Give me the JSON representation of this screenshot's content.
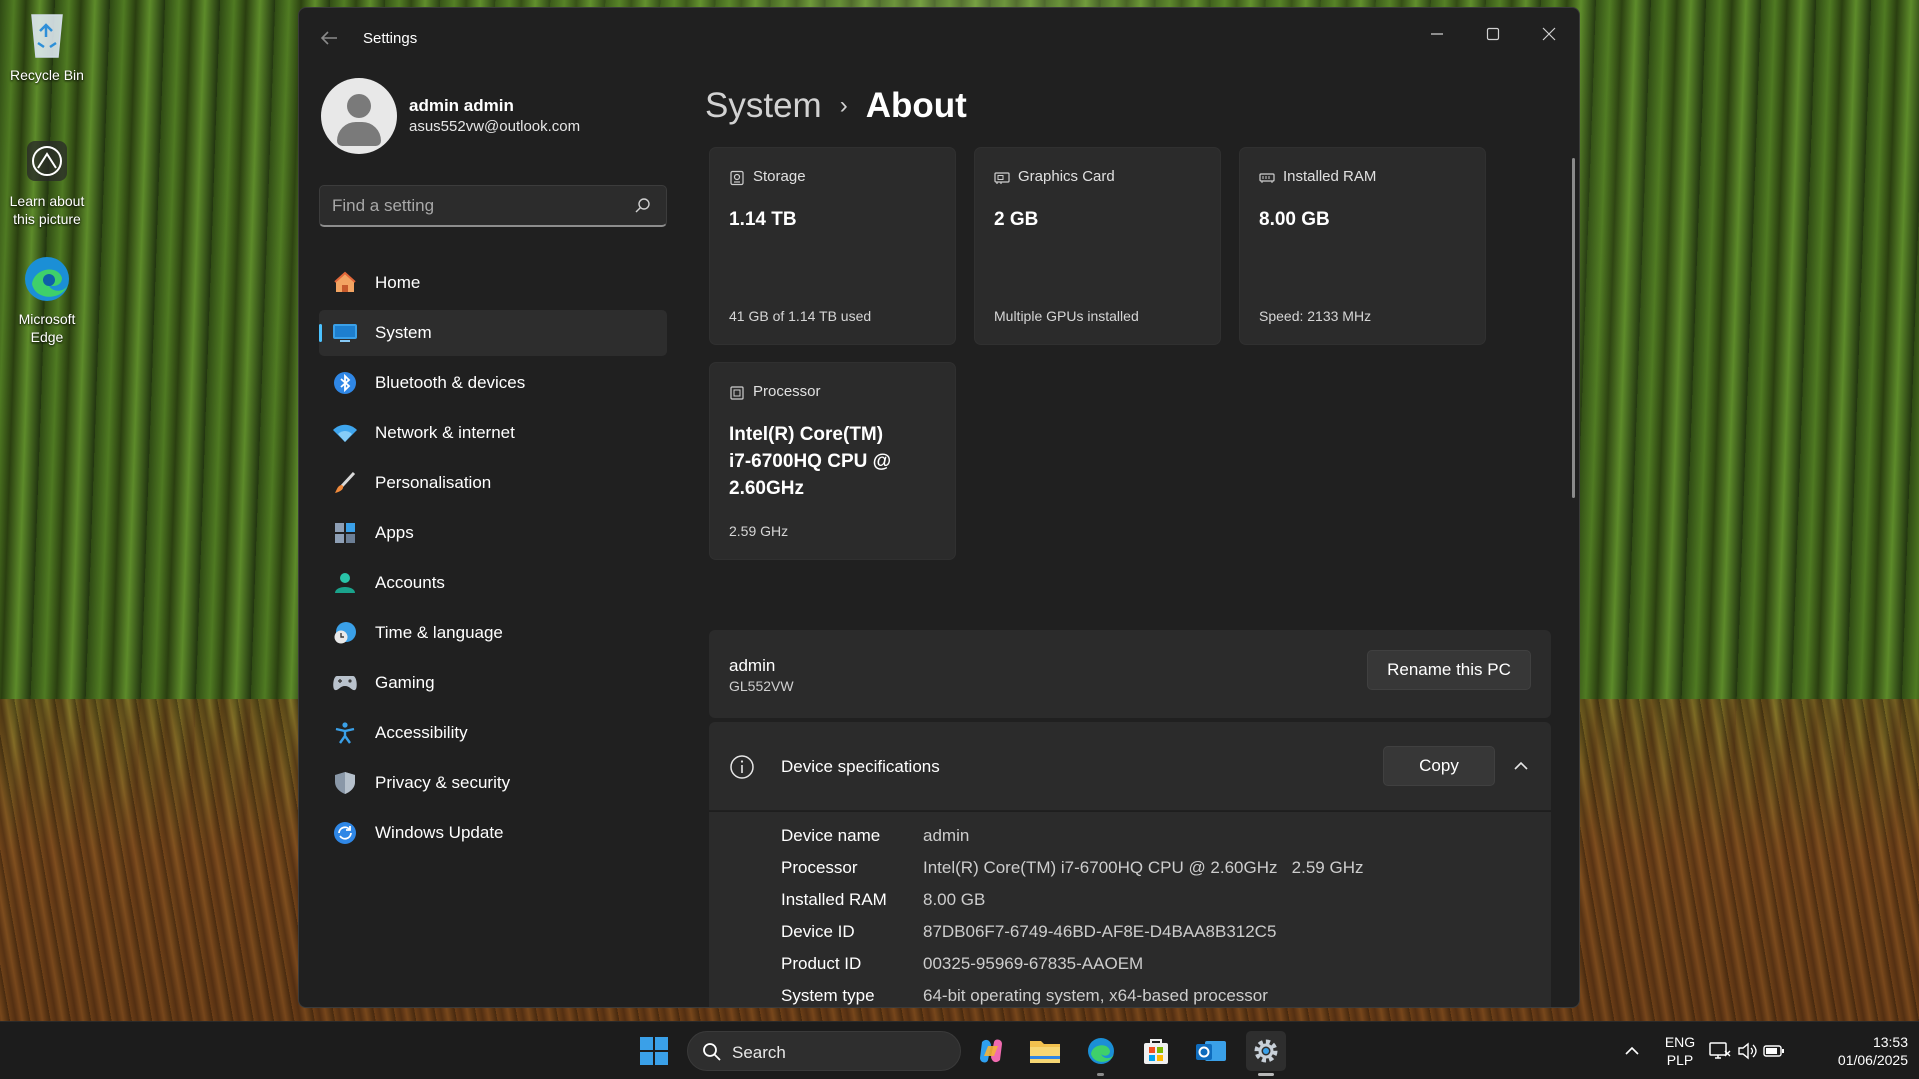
{
  "desktop": {
    "icons": [
      {
        "label": "Recycle Bin"
      },
      {
        "label": "Learn about this picture"
      },
      {
        "label": "Microsoft Edge"
      }
    ]
  },
  "window": {
    "title": "Settings",
    "controls": {
      "minimize": "minimize-icon",
      "maximize": "maximize-icon",
      "close": "close-icon"
    }
  },
  "profile": {
    "name": "admin admin",
    "email": "asus552vw@outlook.com"
  },
  "search": {
    "placeholder": "Find a setting",
    "value": ""
  },
  "nav": {
    "items": [
      {
        "label": "Home",
        "icon": "home-icon"
      },
      {
        "label": "System",
        "icon": "system-icon",
        "active": true
      },
      {
        "label": "Bluetooth & devices",
        "icon": "bluetooth-icon"
      },
      {
        "label": "Network & internet",
        "icon": "wifi-icon"
      },
      {
        "label": "Personalisation",
        "icon": "brush-icon"
      },
      {
        "label": "Apps",
        "icon": "apps-icon"
      },
      {
        "label": "Accounts",
        "icon": "accounts-icon"
      },
      {
        "label": "Time & language",
        "icon": "clock-globe-icon"
      },
      {
        "label": "Gaming",
        "icon": "gamepad-icon"
      },
      {
        "label": "Accessibility",
        "icon": "accessibility-icon"
      },
      {
        "label": "Privacy & security",
        "icon": "shield-icon"
      },
      {
        "label": "Windows Update",
        "icon": "update-icon"
      }
    ]
  },
  "breadcrumb": {
    "parent": "System",
    "separator": "›",
    "current": "About"
  },
  "cards": {
    "storage": {
      "label": "Storage",
      "value": "1.14 TB",
      "sub": "41 GB of 1.14 TB used"
    },
    "graphics": {
      "label": "Graphics Card",
      "value": "2 GB",
      "sub": "Multiple GPUs installed"
    },
    "ram": {
      "label": "Installed RAM",
      "value": "8.00 GB",
      "sub": "Speed: 2133 MHz"
    },
    "processor": {
      "label": "Processor",
      "value_lines": [
        "Intel(R) Core(TM)",
        "i7-6700HQ CPU @",
        "2.60GHz"
      ],
      "sub": "2.59 GHz"
    }
  },
  "pc": {
    "name": "admin",
    "model": "GL552VW",
    "rename_label": "Rename this PC"
  },
  "specs": {
    "title": "Device specifications",
    "copy_label": "Copy",
    "rows": [
      {
        "key": "Device name",
        "value": "admin"
      },
      {
        "key": "Processor",
        "value": "Intel(R) Core(TM) i7-6700HQ CPU @ 2.60GHz   2.59 GHz"
      },
      {
        "key": "Installed RAM",
        "value": "8.00 GB"
      },
      {
        "key": "Device ID",
        "value": "87DB06F7-6749-46BD-AF8E-D4BAA8B312C5"
      },
      {
        "key": "Product ID",
        "value": "00325-95969-67835-AAOEM"
      },
      {
        "key": "System type",
        "value": "64-bit operating system, x64-based processor"
      }
    ]
  },
  "taskbar": {
    "search_label": "Search",
    "lang_top": "ENG",
    "lang_bottom": "PLP",
    "time": "13:53",
    "date": "01/06/2025"
  },
  "colors": {
    "accent": "#4cc2ff",
    "window_bg": "#202020",
    "card_bg": "#2b2b2b"
  }
}
